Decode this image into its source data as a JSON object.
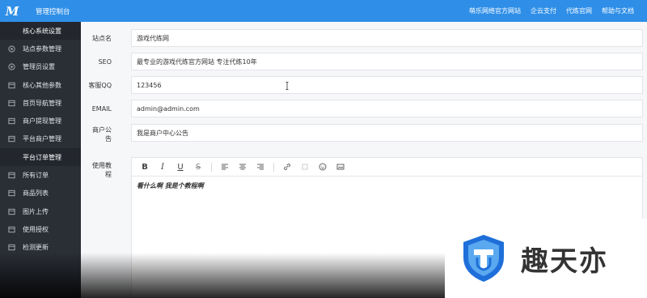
{
  "header": {
    "logo_letter": "M",
    "title": "管理控制台",
    "links": [
      "萌乐网络官方网站",
      "企云支付",
      "代练官网",
      "帮助与文档"
    ]
  },
  "sidebar": {
    "items": [
      {
        "label": "核心系统设置",
        "icon": "none",
        "sub": true
      },
      {
        "label": "站点参数管理",
        "icon": "circle-icon",
        "sub": false
      },
      {
        "label": "管理员设置",
        "icon": "circle-icon",
        "sub": false
      },
      {
        "label": "核心其他参数",
        "icon": "square-icon",
        "sub": false
      },
      {
        "label": "首页导航管理",
        "icon": "square-icon",
        "sub": false
      },
      {
        "label": "商户提现管理",
        "icon": "square-icon",
        "sub": false
      },
      {
        "label": "平台商户管理",
        "icon": "square-icon",
        "sub": false
      },
      {
        "label": "平台订单管理",
        "icon": "none",
        "sub": true
      },
      {
        "label": "所有订单",
        "icon": "square-icon",
        "sub": false
      },
      {
        "label": "商品列表",
        "icon": "square-icon",
        "sub": false
      },
      {
        "label": "图片上传",
        "icon": "square-icon",
        "sub": false
      },
      {
        "label": "使用授权",
        "icon": "square-icon",
        "sub": false
      },
      {
        "label": "检测更新",
        "icon": "square-icon",
        "sub": false
      }
    ]
  },
  "form": {
    "site_name": {
      "label": "站点名",
      "value": "游戏代练网"
    },
    "seo": {
      "label": "SEO",
      "value": "最专业的游戏代练官方网站 专注代练10年"
    },
    "qq": {
      "label": "客服QQ",
      "value": "123456"
    },
    "email": {
      "label": "EMAIL",
      "value": "admin@admin.com"
    },
    "notice": {
      "label_line1": "商户公",
      "label_line2": "告",
      "value": "我是商户中心公告"
    },
    "tutorial": {
      "label_line1": "使用教",
      "label_line2": "程",
      "toolbar": [
        "B",
        "I",
        "U",
        "S"
      ],
      "content": "看什么啊 我是个教程啊"
    }
  },
  "watermark": {
    "text": "趣天亦",
    "color_primary": "#1e6fd9",
    "color_secondary": "#5aa9f0"
  },
  "colors": {
    "topbar": "#2f8fe8",
    "sidebar": "#2a2e35"
  }
}
